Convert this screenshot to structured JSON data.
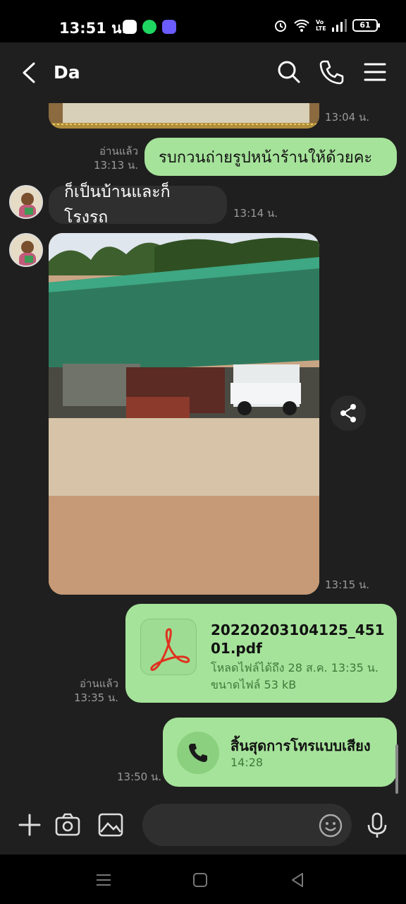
{
  "status_bar": {
    "time": "13:51 น.",
    "battery": "61",
    "network_label": "Vo LTE"
  },
  "header": {
    "title": "Da"
  },
  "messages": [
    {
      "kind": "image-out",
      "time": "13:04 น."
    },
    {
      "kind": "text-out",
      "text": "รบกวนถ่ายรูปหน้าร้านให้ด้วยคะ",
      "read": "อ่านแล้ว",
      "time": "13:13 น."
    },
    {
      "kind": "text-in",
      "text": "ก็เป็นบ้านและก็โรงรถ",
      "time": "13:14 น."
    },
    {
      "kind": "image-in",
      "time": "13:15 น."
    },
    {
      "kind": "file-out",
      "file_name": "20220203104125_45101.pdf",
      "expiry": "โหลดไฟล์ได้ถึง 28 ส.ค. 13:35 น.",
      "size": "ขนาดไฟล์ 53 kB",
      "read": "อ่านแล้ว",
      "time": "13:35 น."
    },
    {
      "kind": "call-out",
      "title": "สิ้นสุดการโทรแบบเสียง",
      "duration": "14:28",
      "time": "13:50 น."
    }
  ],
  "input": {
    "placeholder": ""
  },
  "colors": {
    "outgoing_bubble": "#a5e39a",
    "incoming_bubble": "#2f2f2f",
    "background": "#1f1f1f"
  },
  "icons": [
    "back-icon",
    "search-icon",
    "phone-icon",
    "menu-icon",
    "share-icon",
    "pdf-icon",
    "call-icon",
    "plus-icon",
    "camera-icon",
    "image-icon",
    "emoji-icon",
    "mic-icon"
  ]
}
